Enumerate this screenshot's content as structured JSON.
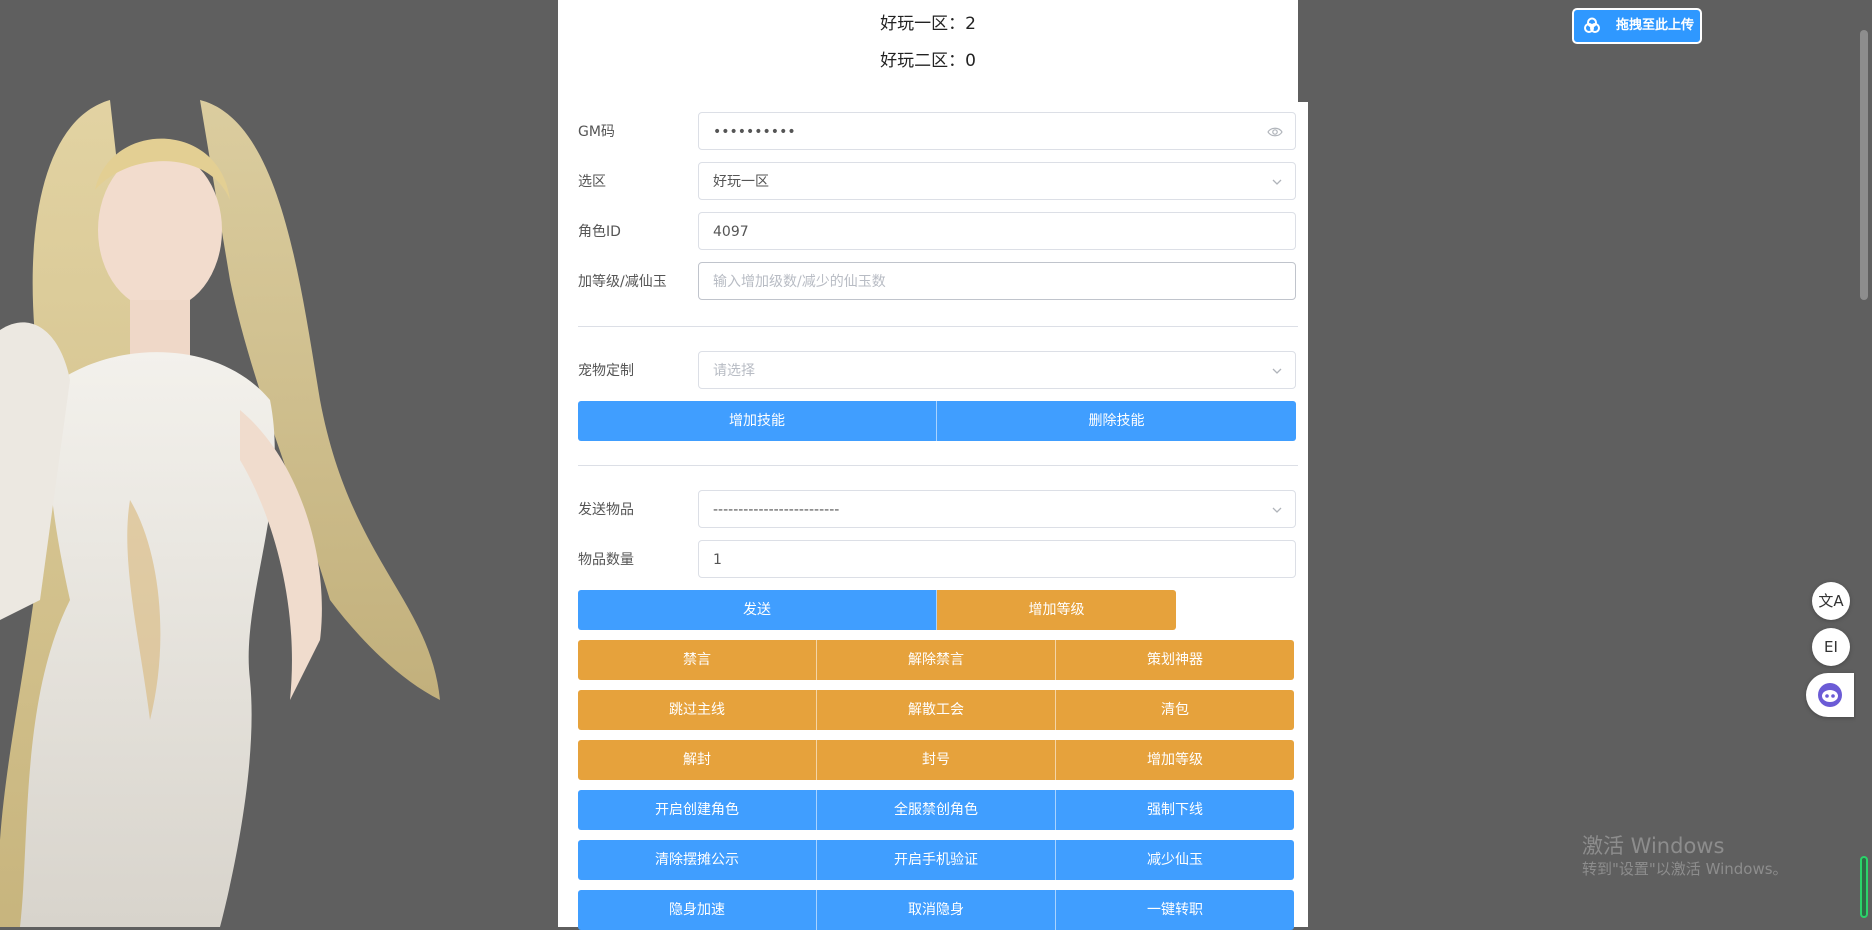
{
  "stats": {
    "zone1": "好玩一区：2",
    "zone2": "好玩二区：0"
  },
  "form": {
    "gm_code": {
      "label": "GM码",
      "value": "••••••••••"
    },
    "zone": {
      "label": "选区",
      "value": "好玩一区"
    },
    "role_id": {
      "label": "角色ID",
      "value": "4097"
    },
    "level": {
      "label": "加等级/减仙玉",
      "placeholder": "输入增加级数/减少的仙玉数"
    },
    "pet": {
      "label": "宠物定制",
      "placeholder": "请选择"
    },
    "item": {
      "label": "发送物品",
      "value": "-------------------------"
    },
    "qty": {
      "label": "物品数量",
      "value": "1"
    }
  },
  "buttons": {
    "add_skill": "增加技能",
    "remove_skill": "删除技能",
    "send": "发送",
    "add_level_1": "增加等级",
    "grid": [
      [
        "禁言",
        "解除禁言",
        "策划神器"
      ],
      [
        "跳过主线",
        "解散工会",
        "清包"
      ],
      [
        "解封",
        "封号",
        "增加等级"
      ],
      [
        "开启创建角色",
        "全服禁创角色",
        "强制下线"
      ],
      [
        "清除摆摊公示",
        "开启手机验证",
        "减少仙玉"
      ],
      [
        "隐身加速",
        "取消隐身",
        "一键转职"
      ]
    ]
  },
  "upload": {
    "label": "拖拽至此上传"
  },
  "tools": {
    "translate": "文A",
    "reader": "EI"
  },
  "watermark": {
    "line1": "激活 Windows",
    "line2": "转到\"设置\"以激活 Windows。"
  },
  "colors": {
    "blue": "#409eff",
    "orange": "#e6a23c",
    "background": "#5f5f5f"
  }
}
